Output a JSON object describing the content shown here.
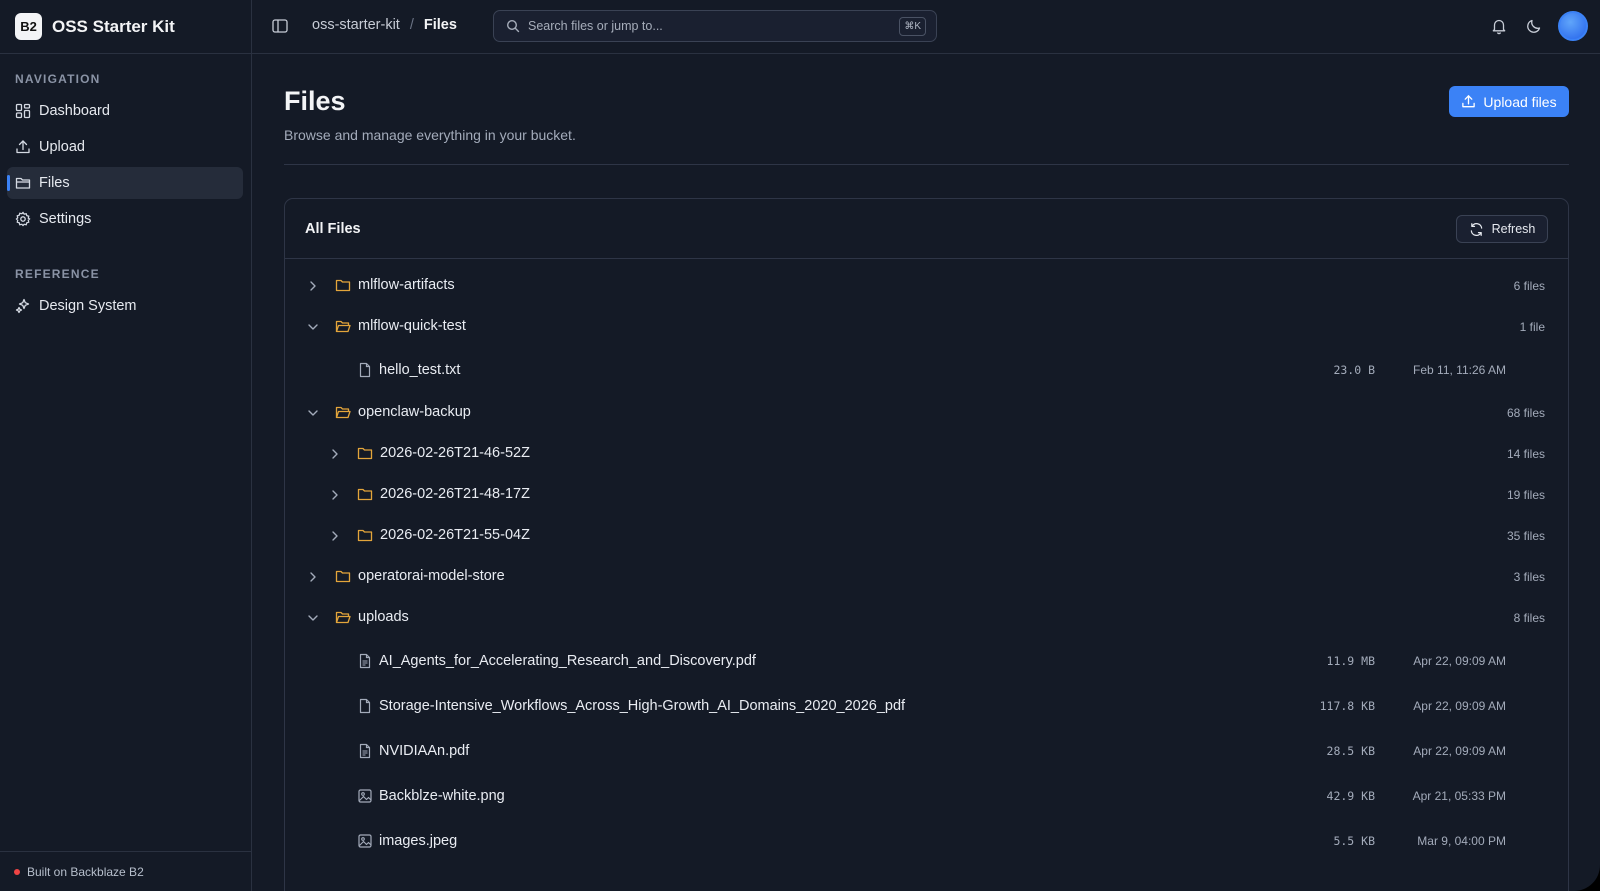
{
  "brand": {
    "logo": "B2",
    "name": "OSS Starter Kit"
  },
  "sidebar": {
    "nav_heading": "NAVIGATION",
    "items": [
      {
        "label": "Dashboard",
        "icon": "dashboard-icon"
      },
      {
        "label": "Upload",
        "icon": "upload-icon"
      },
      {
        "label": "Files",
        "icon": "folder-icon",
        "active": true
      },
      {
        "label": "Settings",
        "icon": "gear-icon"
      }
    ],
    "ref_heading": "REFERENCE",
    "ref_items": [
      {
        "label": "Design System",
        "icon": "sparkles-icon"
      }
    ],
    "footer": "Built on Backblaze B2"
  },
  "topbar": {
    "crumb_root": "oss-starter-kit",
    "crumb_sep": "/",
    "crumb_current": "Files",
    "search_placeholder": "Search files or jump to...",
    "search_shortcut": "⌘K"
  },
  "main": {
    "title": "Files",
    "subtitle": "Browse and manage everything in your bucket.",
    "upload_label": "Upload files",
    "card_title": "All Files",
    "refresh_label": "Refresh"
  },
  "tree": [
    {
      "type": "folder",
      "depth": 0,
      "expanded": false,
      "name": "mlflow-artifacts",
      "count": "6 files"
    },
    {
      "type": "folder",
      "depth": 0,
      "expanded": true,
      "name": "mlflow-quick-test",
      "count": "1 file"
    },
    {
      "type": "file",
      "depth": 1,
      "icon": "file-icon",
      "name": "hello_test.txt",
      "size": "23.0 B",
      "date": "Feb 11, 11:26 AM"
    },
    {
      "type": "folder",
      "depth": 0,
      "expanded": true,
      "name": "openclaw-backup",
      "count": "68 files"
    },
    {
      "type": "folder",
      "depth": 1,
      "expanded": false,
      "name": "2026-02-26T21-46-52Z",
      "count": "14 files"
    },
    {
      "type": "folder",
      "depth": 1,
      "expanded": false,
      "name": "2026-02-26T21-48-17Z",
      "count": "19 files"
    },
    {
      "type": "folder",
      "depth": 1,
      "expanded": false,
      "name": "2026-02-26T21-55-04Z",
      "count": "35 files"
    },
    {
      "type": "folder",
      "depth": 0,
      "expanded": false,
      "name": "operatorai-model-store",
      "count": "3 files"
    },
    {
      "type": "folder",
      "depth": 0,
      "expanded": true,
      "name": "uploads",
      "count": "8 files"
    },
    {
      "type": "file",
      "depth": 1,
      "icon": "document-icon",
      "name": "AI_Agents_for_Accelerating_Research_and_Discovery.pdf",
      "size": "11.9 MB",
      "date": "Apr 22, 09:09 AM"
    },
    {
      "type": "file",
      "depth": 1,
      "icon": "file-icon",
      "name": "Storage-Intensive_Workflows_Across_High-Growth_AI_Domains_2020_2026_pdf",
      "size": "117.8 KB",
      "date": "Apr 22, 09:09 AM"
    },
    {
      "type": "file",
      "depth": 1,
      "icon": "document-icon",
      "name": "NVIDIAAn.pdf",
      "size": "28.5 KB",
      "date": "Apr 22, 09:09 AM"
    },
    {
      "type": "file",
      "depth": 1,
      "icon": "image-icon",
      "name": "Backblze-white.png",
      "size": "42.9 KB",
      "date": "Apr 21, 05:33 PM"
    },
    {
      "type": "file",
      "depth": 1,
      "icon": "image-icon",
      "name": "images.jpeg",
      "size": "5.5 KB",
      "date": "Mar 9, 04:00 PM"
    }
  ],
  "colors": {
    "accent": "#3b82f6",
    "folder": "#e3a53b",
    "background": "#141a26"
  }
}
